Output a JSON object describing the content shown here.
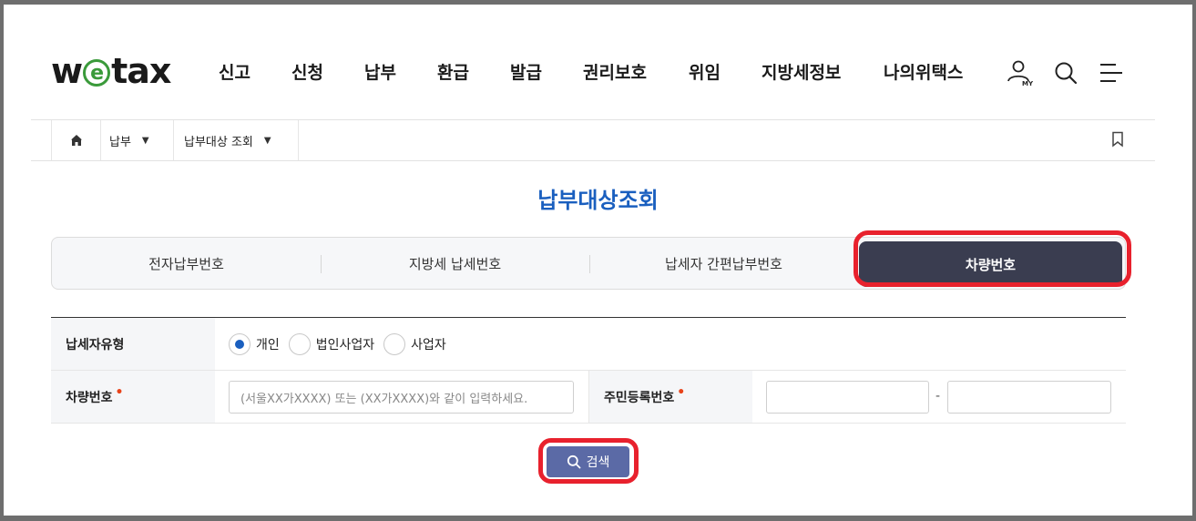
{
  "header": {
    "logo_text_1": "w",
    "logo_text_e": "e",
    "logo_text_2": "tax",
    "nav": [
      "신고",
      "신청",
      "납부",
      "환급",
      "발급",
      "권리보호",
      "위임",
      "지방세정보",
      "나의위택스"
    ],
    "icons": [
      "my-icon",
      "search-icon",
      "menu-icon"
    ],
    "my_badge": "MY"
  },
  "breadcrumb": {
    "home_icon": "home-icon",
    "items": [
      "납부",
      "납부대상 조회"
    ],
    "bookmark_icon": "bookmark-icon"
  },
  "page": {
    "title": "납부대상조회"
  },
  "tabs": {
    "items": [
      "전자납부번호",
      "지방세 납세번호",
      "납세자 간편납부번호",
      "차량번호"
    ],
    "active_index": 3
  },
  "form": {
    "taxpayer_type_label": "납세자유형",
    "radio_options": [
      "개인",
      "법인사업자",
      "사업자"
    ],
    "selected_radio": "개인",
    "vehicle_label": "차량번호",
    "vehicle_placeholder": "(서울XX가XXXX) 또는 (XX가XXXX)와 같이 입력하세요.",
    "rrn_label": "주민등록번호",
    "rrn_separator": "-"
  },
  "search_button": {
    "label": "검색",
    "icon": "search-icon"
  },
  "colors": {
    "title_blue": "#1a5fbf",
    "active_tab": "#3a3d50",
    "search_button": "#5b6aa6",
    "highlight_red": "#e8212d",
    "required_dot": "#e8431a"
  }
}
